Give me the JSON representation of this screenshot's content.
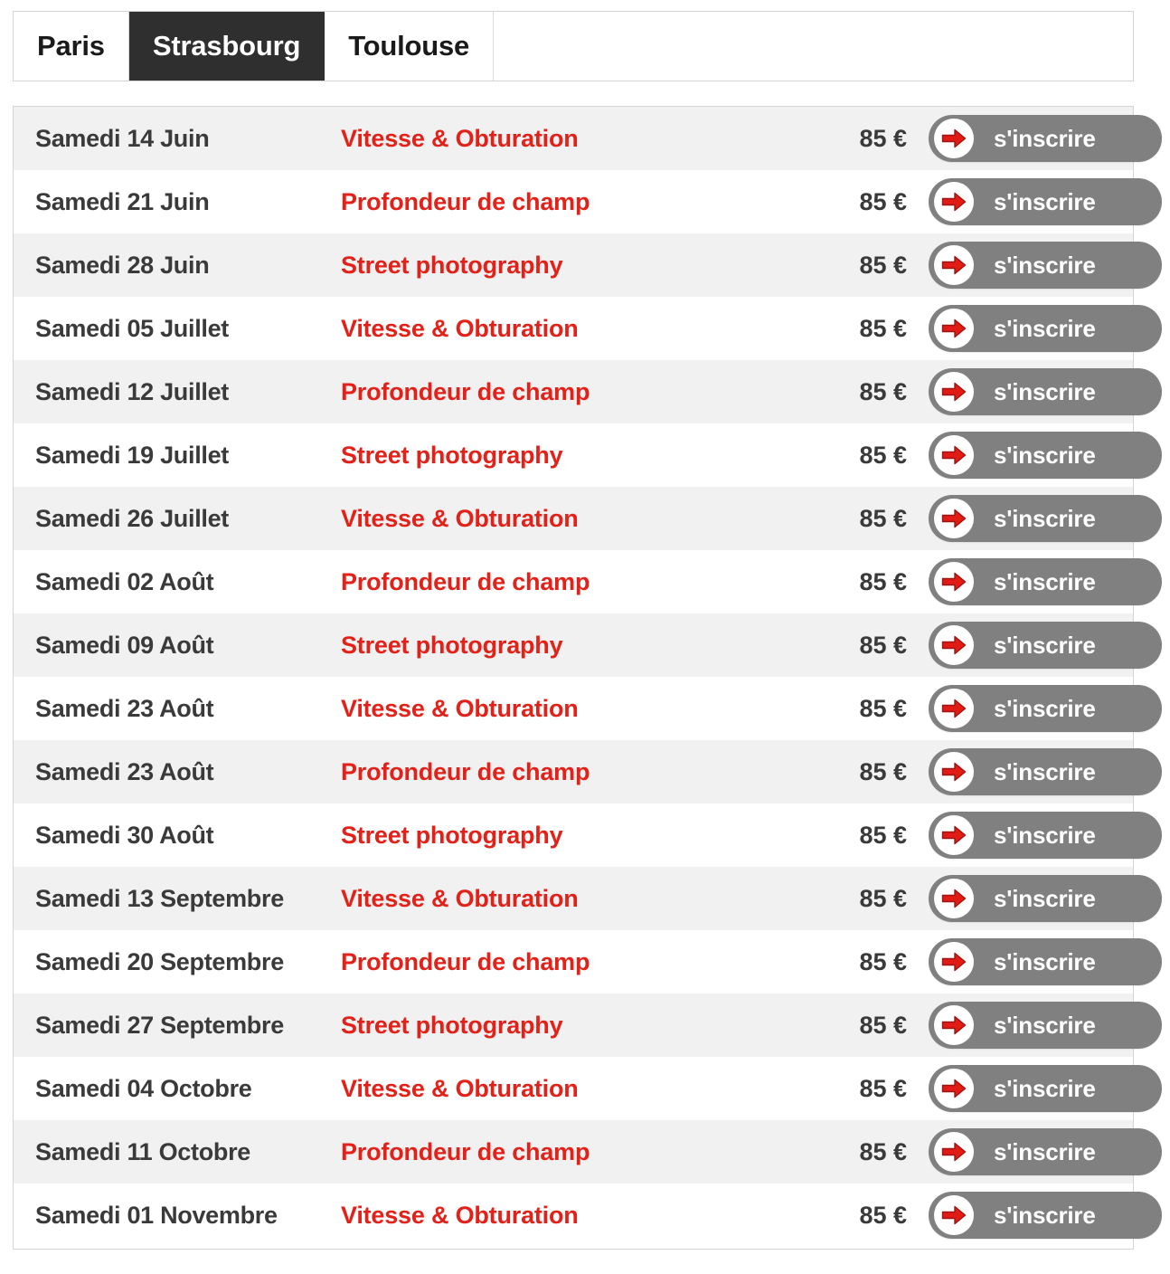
{
  "tabs": {
    "items": [
      {
        "label": "Paris",
        "active": false
      },
      {
        "label": "Strasbourg",
        "active": true
      },
      {
        "label": "Toulouse",
        "active": false
      }
    ]
  },
  "colors": {
    "accent_red": "#e32119",
    "active_tab_bg": "#2f2f2f",
    "button_bg": "#808080",
    "row_alt_bg": "#f1f1f1",
    "text_dark": "#3a3a3a",
    "border": "#d4d4d4"
  },
  "table": {
    "button_label": "s'inscrire",
    "button_icon": "arrow-right-icon",
    "rows": [
      {
        "date": "Samedi 14 Juin",
        "course": "Vitesse & Obturation",
        "price": "85 €",
        "action": "s'inscrire"
      },
      {
        "date": "Samedi 21 Juin",
        "course": "Profondeur de champ",
        "price": "85 €",
        "action": "s'inscrire"
      },
      {
        "date": "Samedi 28 Juin",
        "course": "Street photography",
        "price": "85 €",
        "action": "s'inscrire"
      },
      {
        "date": "Samedi 05 Juillet",
        "course": "Vitesse & Obturation",
        "price": "85 €",
        "action": "s'inscrire"
      },
      {
        "date": "Samedi 12 Juillet",
        "course": "Profondeur de champ",
        "price": "85 €",
        "action": "s'inscrire"
      },
      {
        "date": "Samedi 19 Juillet",
        "course": "Street photography",
        "price": "85 €",
        "action": "s'inscrire"
      },
      {
        "date": "Samedi 26 Juillet",
        "course": "Vitesse & Obturation",
        "price": "85 €",
        "action": "s'inscrire"
      },
      {
        "date": "Samedi 02 Août",
        "course": "Profondeur de champ",
        "price": "85 €",
        "action": "s'inscrire"
      },
      {
        "date": "Samedi 09 Août",
        "course": "Street photography",
        "price": "85 €",
        "action": "s'inscrire"
      },
      {
        "date": "Samedi 23 Août",
        "course": "Vitesse & Obturation",
        "price": "85 €",
        "action": "s'inscrire"
      },
      {
        "date": "Samedi 23 Août",
        "course": "Profondeur de champ",
        "price": "85 €",
        "action": "s'inscrire"
      },
      {
        "date": "Samedi 30 Août",
        "course": "Street photography",
        "price": "85 €",
        "action": "s'inscrire"
      },
      {
        "date": "Samedi 13 Septembre",
        "course": "Vitesse & Obturation",
        "price": "85 €",
        "action": "s'inscrire"
      },
      {
        "date": "Samedi 20 Septembre",
        "course": "Profondeur de champ",
        "price": "85 €",
        "action": "s'inscrire"
      },
      {
        "date": "Samedi 27 Septembre",
        "course": "Street photography",
        "price": "85 €",
        "action": "s'inscrire"
      },
      {
        "date": "Samedi 04 Octobre",
        "course": "Vitesse & Obturation",
        "price": "85 €",
        "action": "s'inscrire"
      },
      {
        "date": "Samedi 11 Octobre",
        "course": "Profondeur de champ",
        "price": "85 €",
        "action": "s'inscrire"
      },
      {
        "date": "Samedi 01 Novembre",
        "course": "Vitesse & Obturation",
        "price": "85 €",
        "action": "s'inscrire"
      }
    ]
  }
}
